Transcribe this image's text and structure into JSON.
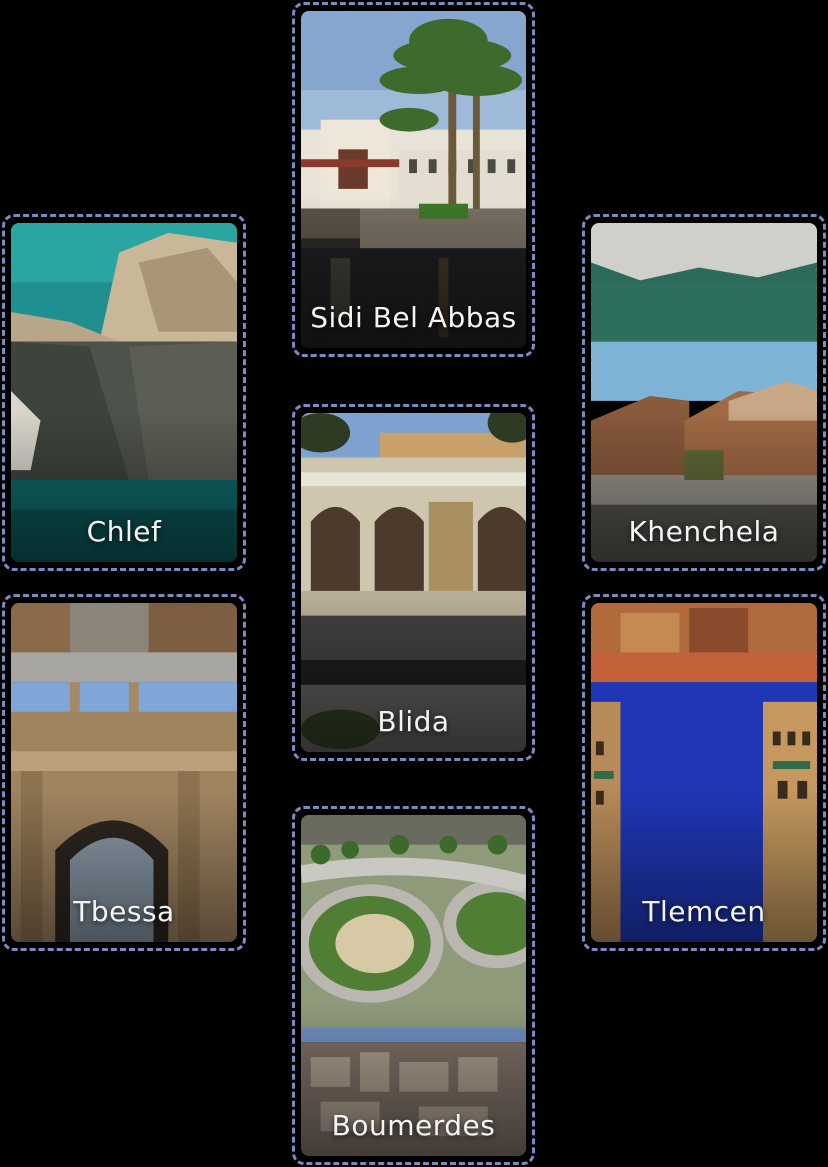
{
  "cities": [
    {
      "id": "sidi-bel-abbas",
      "name": "Sidi Bel Abbas",
      "icon": "palm-building-photo"
    },
    {
      "id": "chlef",
      "name": "Chlef",
      "icon": "coastal-cliff-photo"
    },
    {
      "id": "khenchela",
      "name": "Khenchela",
      "icon": "canyon-lake-photo"
    },
    {
      "id": "blida",
      "name": "Blida",
      "icon": "kiosk-square-photo"
    },
    {
      "id": "tbessa",
      "name": "Tbessa",
      "icon": "roman-arch-photo"
    },
    {
      "id": "tlemcen",
      "name": "Tlemcen",
      "icon": "minaret-ruins-photo"
    },
    {
      "id": "boumerdes",
      "name": "Boumerdes",
      "icon": "roundabout-city-photo"
    }
  ],
  "colors": {
    "background": "#000000",
    "frame": "#7c8bbf",
    "label": "#f4f4f4"
  }
}
